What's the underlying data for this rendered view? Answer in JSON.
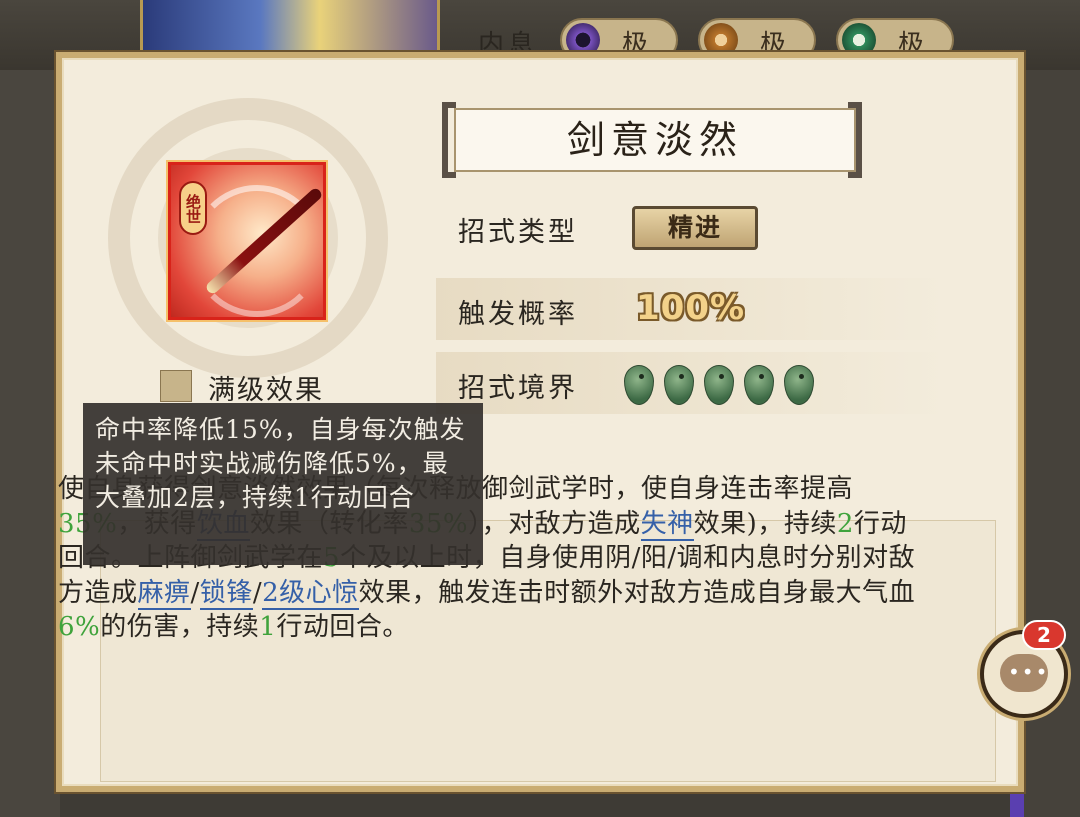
{
  "background": {
    "neixi_label": "内息",
    "neixi_chips": [
      {
        "label": "极",
        "orb_color": "#6a3fa0"
      },
      {
        "label": "极",
        "orb_color": "#b8742a"
      },
      {
        "label": "极",
        "orb_color": "#2f8a5a"
      }
    ]
  },
  "skill": {
    "name": "剑意淡然",
    "icon_badge": "绝世",
    "type_label": "招式类型",
    "type_value": "精进",
    "rate_label": "触发概率",
    "rate_value": "100%",
    "realm_label": "招式境界",
    "realm_level": 5,
    "max_effect_label": "满级效果"
  },
  "tooltip": {
    "text": "命中率降低15%，自身每次触发未命中时实战减伤降低5%，最大叠加2层，持续1行动回合"
  },
  "description": {
    "segments": [
      {
        "t": "使自身获得剑意淡然效果（每次释放御剑武学时，使自身连击率提高"
      },
      {
        "t": "35%",
        "s": "g"
      },
      {
        "t": "，获得"
      },
      {
        "t": "饮血",
        "s": "k"
      },
      {
        "t": "效果（转化率"
      },
      {
        "t": "35%",
        "s": "g"
      },
      {
        "t": "），对敌方造成"
      },
      {
        "t": "失神",
        "s": "k"
      },
      {
        "t": "效果)，持续"
      },
      {
        "t": "2",
        "s": "g"
      },
      {
        "t": "行动回合。上阵御剑武学在"
      },
      {
        "t": "5",
        "s": "g"
      },
      {
        "t": "个及以上时，自身使用阴/阳/调和内息时分别对敌方造成"
      },
      {
        "t": "麻痹",
        "s": "k"
      },
      {
        "t": "/"
      },
      {
        "t": "锁锋",
        "s": "k"
      },
      {
        "t": "/"
      },
      {
        "t": "2级心惊",
        "s": "k"
      },
      {
        "t": "效果，触发连击时额外对敌方造成自身最大气血"
      },
      {
        "t": "6%",
        "s": "g"
      },
      {
        "t": "的伤害，持续"
      },
      {
        "t": "1",
        "s": "g"
      },
      {
        "t": "行动回合。"
      }
    ]
  },
  "chat": {
    "badge_count": "2",
    "dots": "•••"
  }
}
